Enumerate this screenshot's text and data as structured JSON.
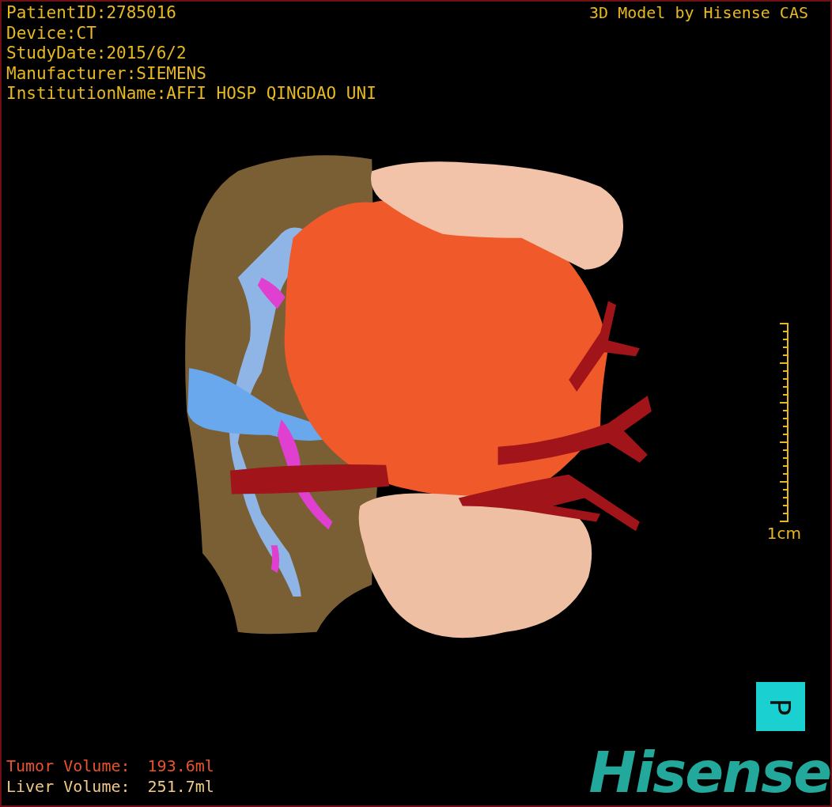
{
  "study_info": [
    "PatientID:2785016",
    "Device:CT",
    "StudyDate:2015/6/2",
    "Manufacturer:SIEMENS",
    "InstitutionName:AFFI HOSP QINGDAO UNI"
  ],
  "header_right": "3D Model by Hisense CAS",
  "scale_bar": {
    "label": "1cm"
  },
  "orientation_marker": {
    "label": "P"
  },
  "volumes": [
    {
      "label": "Tumor Volume:",
      "value": "193.6ml",
      "color": "#e8532e"
    },
    {
      "label": "Liver Volume:",
      "value": "251.7ml",
      "color": "#f0c88a"
    }
  ],
  "logo": "Hisense"
}
